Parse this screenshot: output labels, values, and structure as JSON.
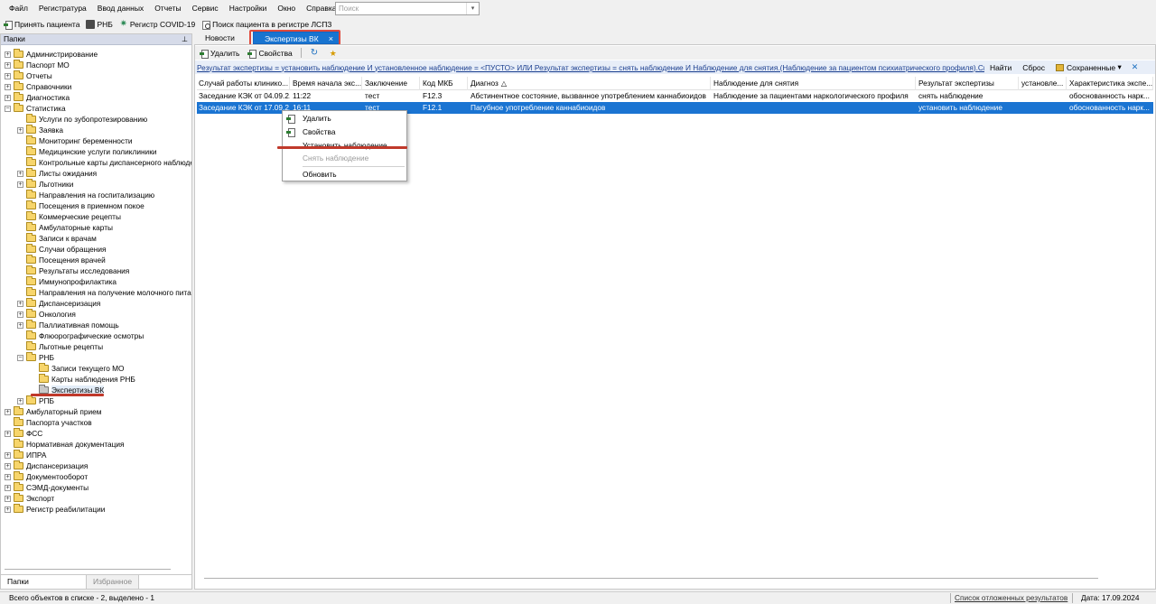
{
  "menu": [
    "Файл",
    "Регистратура",
    "Ввод данных",
    "Отчеты",
    "Сервис",
    "Настройки",
    "Окно",
    "Справка"
  ],
  "search": {
    "placeholder": "Поиск"
  },
  "toolbar": {
    "accept_patient": "Принять пациента",
    "rnb": "РНБ",
    "covid": "Регистр COVID-19",
    "search_patient": "Поиск пациента в регистре ЛСПЗ"
  },
  "left_panel": {
    "header": "Папки",
    "tree": [
      {
        "label": "Администрирование"
      },
      {
        "label": "Паспорт МО"
      },
      {
        "label": "Отчеты"
      },
      {
        "label": "Справочники"
      },
      {
        "label": "Диагностика"
      },
      {
        "label": "Статистика"
      },
      {
        "label": "Услуги по зубопротезированию"
      },
      {
        "label": "Заявка"
      },
      {
        "label": "Мониторинг беременности"
      },
      {
        "label": "Медицинские услуги поликлиники"
      },
      {
        "label": "Контрольные карты диспансерного наблюдения"
      },
      {
        "label": "Листы ожидания"
      },
      {
        "label": "Льготники"
      },
      {
        "label": "Направления на госпитализацию"
      },
      {
        "label": "Посещения в приемном покое"
      },
      {
        "label": "Коммерческие рецепты"
      },
      {
        "label": "Амбулаторные карты"
      },
      {
        "label": "Записи к врачам"
      },
      {
        "label": "Случаи обращения"
      },
      {
        "label": "Посещения врачей"
      },
      {
        "label": "Результаты исследования"
      },
      {
        "label": "Иммунопрофилактика"
      },
      {
        "label": "Направления на получение молочного питания"
      },
      {
        "label": "Диспансеризация"
      },
      {
        "label": "Онкология"
      },
      {
        "label": "Паллиативная помощь"
      },
      {
        "label": "Флюорографические осмотры"
      },
      {
        "label": "Льготные рецепты"
      },
      {
        "label": "РНБ"
      },
      {
        "label": "Записи текущего МО"
      },
      {
        "label": "Карты наблюдения РНБ"
      },
      {
        "label": "Экспертизы ВК"
      },
      {
        "label": "РПБ"
      },
      {
        "label": "Амбулаторный прием"
      },
      {
        "label": "Паспорта участков"
      },
      {
        "label": "ФСС"
      },
      {
        "label": "Нормативная документация"
      },
      {
        "label": "ИПРА"
      },
      {
        "label": "Диспансеризация"
      },
      {
        "label": "Документооборот"
      },
      {
        "label": "СЭМД-документы"
      },
      {
        "label": "Экспорт"
      },
      {
        "label": "Регистр реабилитации"
      }
    ],
    "tabs": {
      "folders": "Папки",
      "favorites": "Избранное"
    }
  },
  "tabs": {
    "news": "Новости",
    "active": "Экспертизы ВК",
    "close": "×"
  },
  "doc_toolbar": {
    "delete": "Удалить",
    "properties": "Свойства"
  },
  "filter": {
    "text": "Результат экспертизы = установить наблюдение И установленное наблюдение = <ПУСТО> ИЛИ Результат экспертизы = снять наблюдение И Наблюдение для снятия.(Наблюдение за пациентом психиатрического профиля).Снятие с ди",
    "find": "Найти",
    "reset": "Сброс",
    "saved": "Сохраненные",
    "close": "✕"
  },
  "table": {
    "headers": [
      "Случай работы клинико...",
      "Время начала экс...",
      "Заключение",
      "Код МКБ",
      "Диагноз",
      "Наблюдение для снятия",
      "Результат экспертизы",
      "установле...",
      "Характеристика экспе..."
    ],
    "rows": [
      [
        "Заседание КЭК от 04.09.2...",
        "11:22",
        "тест",
        "F12.3",
        "Абстинентное состояние, вызванное употреблением каннабиоидов",
        "Наблюдение за пациентами наркологического профиля",
        "снять наблюдение",
        "",
        "обоснованность нарк..."
      ],
      [
        "Заседание КЭК от 17.09.2...",
        "16:11",
        "тест",
        "F12.1",
        "Пагубное употребление каннабиоидов",
        "",
        "установить наблюдение",
        "",
        "обоснованность нарк..."
      ]
    ]
  },
  "context_menu": {
    "delete": "Удалить",
    "properties": "Свойства",
    "set_observation": "Установить наблюдение",
    "remove_observation": "Снять наблюдение",
    "refresh": "Обновить"
  },
  "status": {
    "count": "Всего объектов в списке - 2, выделено - 1",
    "deferred": "Список отложенных результатов",
    "date": "Дата: 17.09.2024"
  },
  "colors": {
    "selection": "#1a74d2",
    "tab_active": "#1874d0",
    "highlight": "#e04a3c",
    "underline": "#c0392b"
  }
}
